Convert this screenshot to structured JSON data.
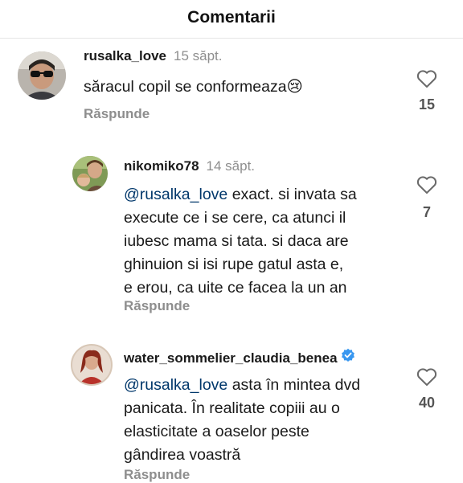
{
  "header": {
    "title": "Comentarii"
  },
  "comments": [
    {
      "username": "rusalka_love",
      "time": "15 săpt.",
      "text": "săracul copil se conformeaza😢",
      "reply_label": "Răspunde",
      "likes": "15"
    },
    {
      "username": "nikomiko78",
      "time": "14 săpt.",
      "mention": "@rusalka_love",
      "lines": [
        " exact. si invata sa",
        "execute ce i se cere, ca atunci il",
        "iubesc mama si tata. si daca are",
        "ghinuion si isi rupe gatul  asta e,",
        "e erou, ca uite ce facea la un an"
      ],
      "reply_label": "Răspunde",
      "likes": "7"
    },
    {
      "username": "water_sommelier_claudia_benea",
      "verified": true,
      "mention": "@rusalka_love",
      "lines": [
        " asta în mintea dvd",
        "panicata. În realitate copiii au o",
        "elasticitate a oaselor peste",
        "gândirea voastră"
      ],
      "reply_label": "Răspunde",
      "likes": "40"
    }
  ],
  "icons": {
    "heart": "heart-outline-icon",
    "verified": "verified-badge-icon",
    "verified_color": "#3897f0"
  }
}
